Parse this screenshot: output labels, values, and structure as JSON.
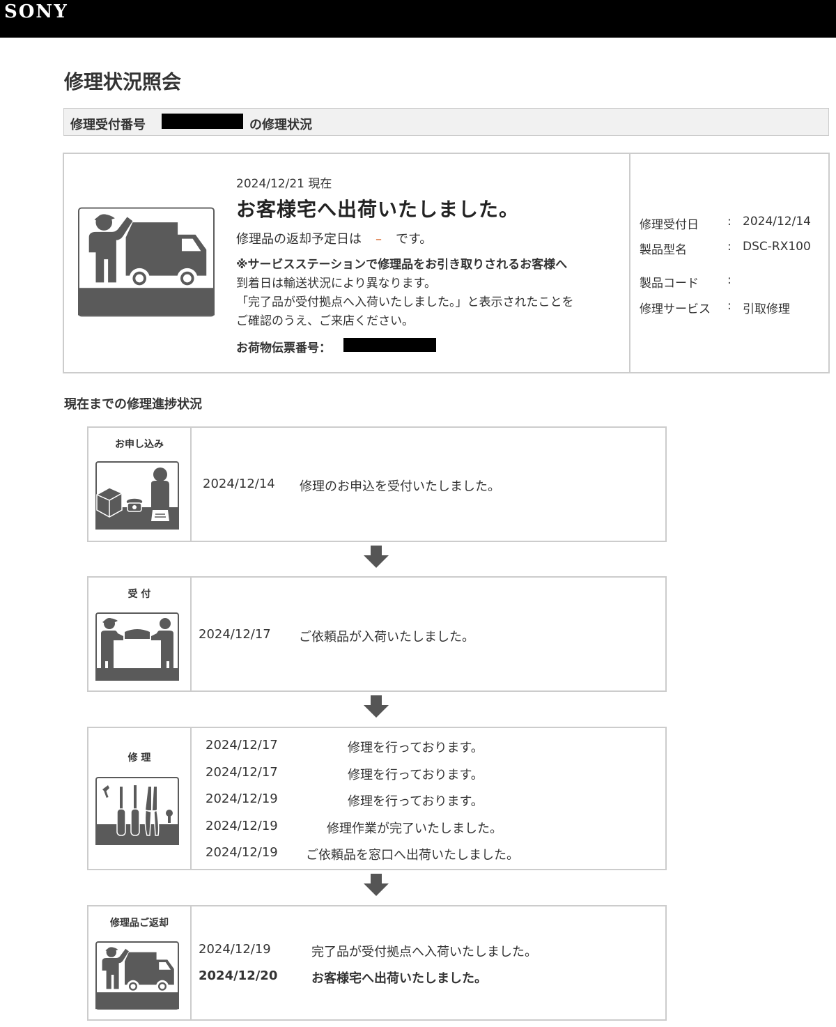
{
  "brand": {
    "logo_text": "SONY"
  },
  "page": {
    "title": "修理状況照会"
  },
  "reception": {
    "label": "修理受付番号",
    "suffix": "の修理状況"
  },
  "status": {
    "as_of": "2024/12/21 現在",
    "headline": "お客様宅へ出荷いたしました。",
    "return_prefix": "修理品の返却予定日は",
    "return_date": "–",
    "return_suffix": "です。",
    "note_lines": [
      "※サービスステーションで修理品をお引き取りされるお客様へ",
      "到着日は輸送状況により異なります。",
      "「完了品が受付拠点へ入荷いたしました。」と表示されたことを",
      "ご確認のうえ、ご来店ください。"
    ],
    "slip_label": "お荷物伝票番号："
  },
  "info": [
    {
      "label": "修理受付日",
      "sep": ":",
      "value": "2024/12/14"
    },
    {
      "label": "製品型名",
      "sep": ":",
      "value": "DSC-RX100"
    },
    {
      "label": "製品コード",
      "sep": ":",
      "value": ""
    },
    {
      "label": "修理サービス",
      "sep": ":",
      "value": "引取修理"
    }
  ],
  "progress": {
    "title": "現在までの修理進捗状況",
    "steps": [
      {
        "label": "お申し込み",
        "icon": "application-icon",
        "rows": [
          {
            "date": "2024/12/14",
            "text": "修理のお申込を受付いたしました。"
          }
        ]
      },
      {
        "label": "受 付",
        "icon": "reception-icon",
        "rows": [
          {
            "date": "2024/12/17",
            "text": "ご依頼品が入荷いたしました。"
          }
        ]
      },
      {
        "label": "修 理",
        "icon": "repair-tools-icon",
        "rows": [
          {
            "date": "2024/12/17",
            "text": "修理を行っております。"
          },
          {
            "date": "2024/12/17",
            "text": "修理を行っております。"
          },
          {
            "date": "2024/12/19",
            "text": "修理を行っております。"
          },
          {
            "date": "2024/12/19",
            "text": "修理作業が完了いたしました。"
          },
          {
            "date": "2024/12/19",
            "text": "ご依頼品を窓口へ出荷いたしました。"
          }
        ]
      },
      {
        "label": "修理品ご返却",
        "icon": "delivery-truck-icon",
        "rows": [
          {
            "date": "2024/12/19",
            "text": "完了品が受付拠点へ入荷いたしました。"
          },
          {
            "date": "2024/12/20",
            "text": "お客様宅へ出荷いたしました。"
          }
        ]
      }
    ]
  },
  "colors": {
    "header_bg": "#000000",
    "icon_gray": "#5a5a5a",
    "return_dash": "#d9662b"
  }
}
